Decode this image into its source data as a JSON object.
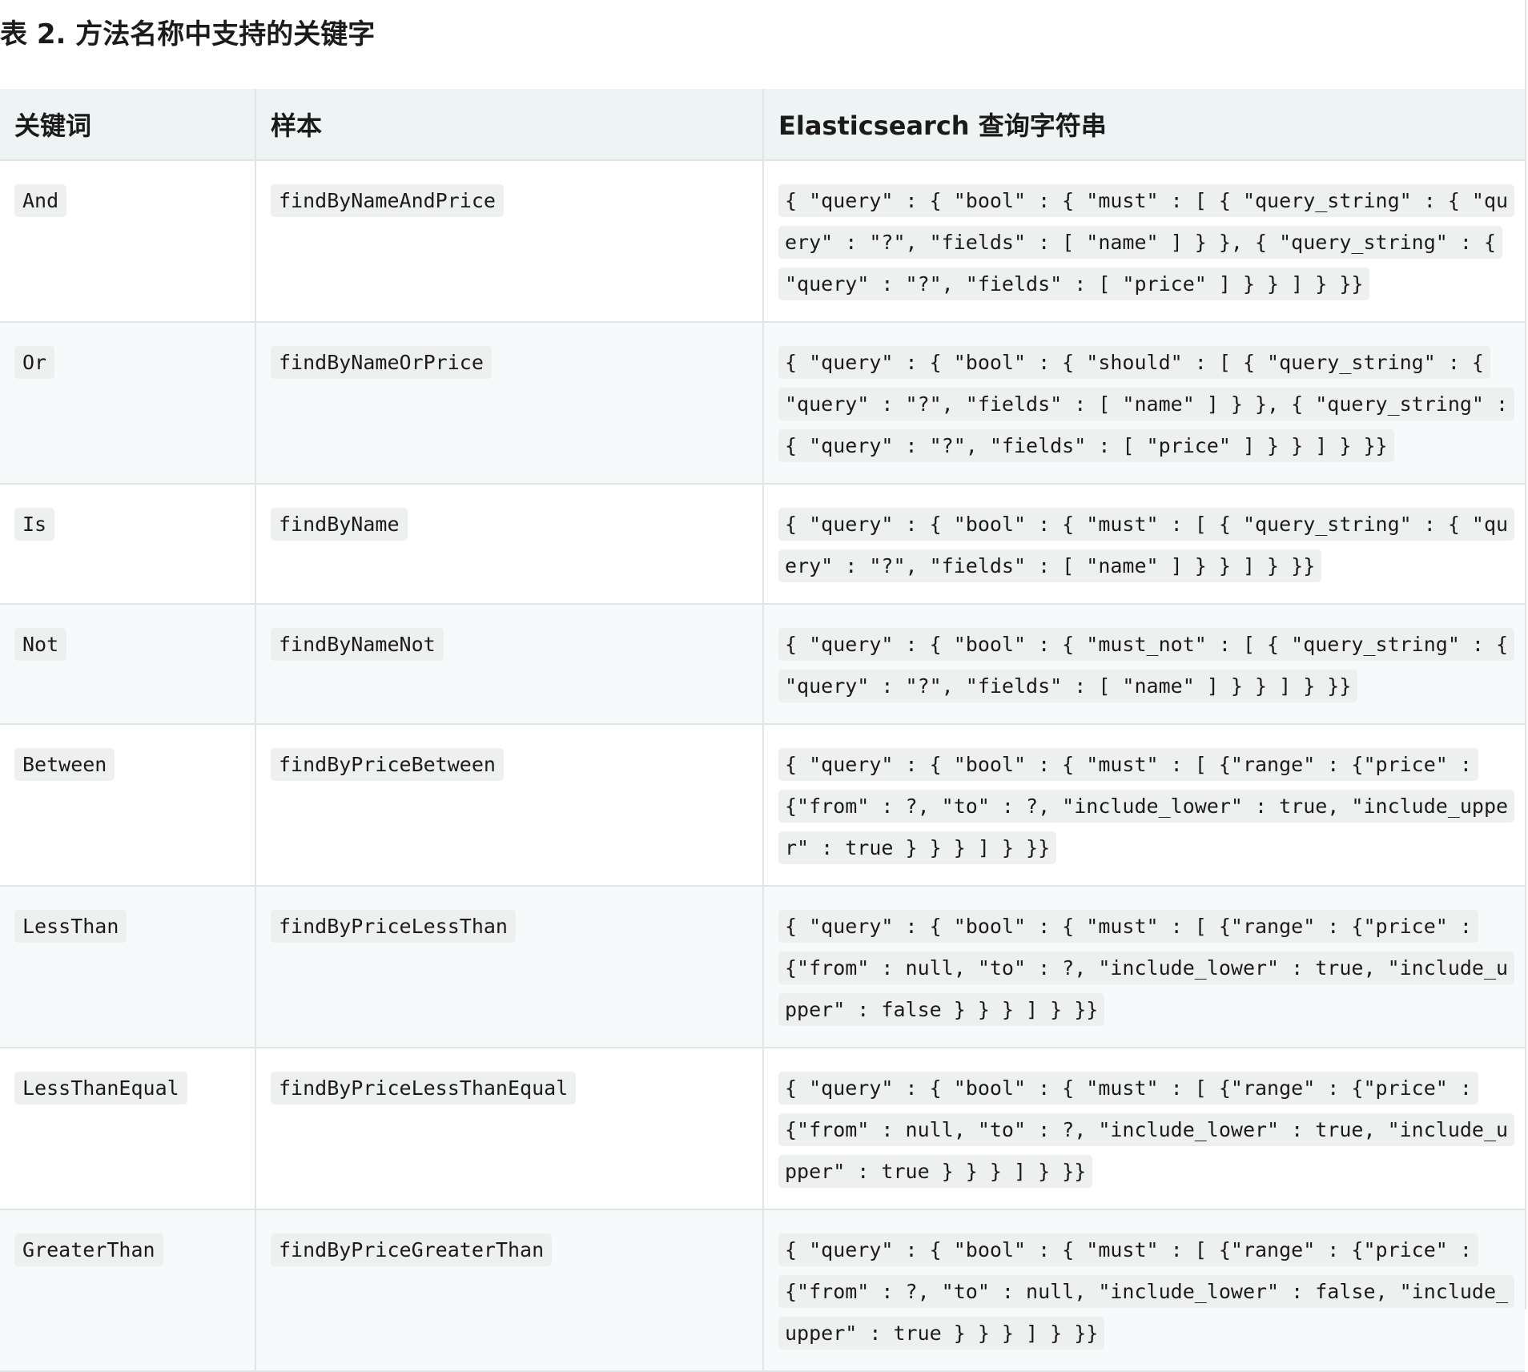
{
  "caption": "表 2. 方法名称中支持的关键字",
  "table": {
    "headers": {
      "keyword": "关键词",
      "sample": "样本",
      "query": "Elasticsearch 查询字符串"
    },
    "rows": [
      {
        "keyword": "And",
        "sample": "findByNameAndPrice",
        "query": "{ \"query\" : { \"bool\" : { \"must\" : [ { \"query_string\" : { \"query\" : \"?\", \"fields\" : [ \"name\" ] } }, { \"query_string\" : { \"query\" : \"?\", \"fields\" : [ \"price\" ] } } ] } }}"
      },
      {
        "keyword": "Or",
        "sample": "findByNameOrPrice",
        "query": "{ \"query\" : { \"bool\" : { \"should\" : [ { \"query_string\" : { \"query\" : \"?\", \"fields\" : [ \"name\" ] } }, { \"query_string\" : { \"query\" : \"?\", \"fields\" : [ \"price\" ] } } ] } }}"
      },
      {
        "keyword": "Is",
        "sample": "findByName",
        "query": "{ \"query\" : { \"bool\" : { \"must\" : [ { \"query_string\" : { \"query\" : \"?\", \"fields\" : [ \"name\" ] } } ] } }}"
      },
      {
        "keyword": "Not",
        "sample": "findByNameNot",
        "query": "{ \"query\" : { \"bool\" : { \"must_not\" : [ { \"query_string\" : { \"query\" : \"?\", \"fields\" : [ \"name\" ] } } ] } }}"
      },
      {
        "keyword": "Between",
        "sample": "findByPriceBetween",
        "query": "{ \"query\" : { \"bool\" : { \"must\" : [ {\"range\" : {\"price\" : {\"from\" : ?, \"to\" : ?, \"include_lower\" : true, \"include_upper\" : true } } } ] } }}"
      },
      {
        "keyword": "LessThan",
        "sample": "findByPriceLessThan",
        "query": "{ \"query\" : { \"bool\" : { \"must\" : [ {\"range\" : {\"price\" : {\"from\" : null, \"to\" : ?, \"include_lower\" : true, \"include_upper\" : false } } } ] } }}"
      },
      {
        "keyword": "LessThanEqual",
        "sample": "findByPriceLessThanEqual",
        "query": "{ \"query\" : { \"bool\" : { \"must\" : [ {\"range\" : {\"price\" : {\"from\" : null, \"to\" : ?, \"include_lower\" : true, \"include_upper\" : true } } } ] } }}"
      },
      {
        "keyword": "GreaterThan",
        "sample": "findByPriceGreaterThan",
        "query": "{ \"query\" : { \"bool\" : { \"must\" : [ {\"range\" : {\"price\" : {\"from\" : ?, \"to\" : null, \"include_lower\" : false, \"include_upper\" : true } } } ] } }}"
      }
    ]
  }
}
